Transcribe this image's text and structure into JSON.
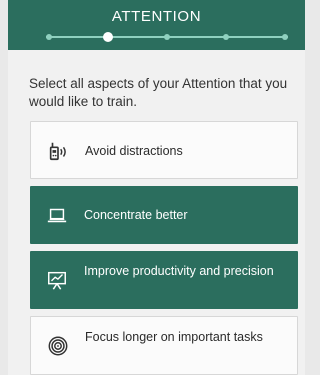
{
  "header": {
    "title": "ATTENTION",
    "progress": {
      "steps": 5,
      "current_step": 2
    }
  },
  "instruction": "Select all aspects of your Attention that you would like to train.",
  "options": [
    {
      "label": "Avoid distractions",
      "icon": "walkie-talkie-icon",
      "selected": false
    },
    {
      "label": "Concentrate better",
      "icon": "laptop-icon",
      "selected": true
    },
    {
      "label": "Improve productivity and precision",
      "icon": "presentation-chart-icon",
      "selected": true
    },
    {
      "label": "Focus longer on important tasks",
      "icon": "target-icon",
      "selected": false
    }
  ],
  "colors": {
    "primary": "#2b6e5e",
    "progress_track": "#8fd0bf",
    "card": "#fbfbfb",
    "background": "#f1f1f1"
  }
}
